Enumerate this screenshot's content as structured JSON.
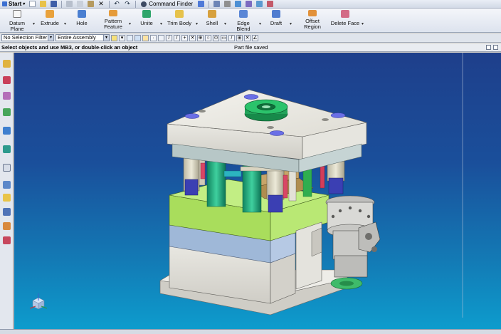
{
  "app": {
    "start_label": "Start",
    "command_finder_label": "Command Finder"
  },
  "ribbon": {
    "datum_plane": "Datum Plane",
    "extrude": "Extrude",
    "hole": "Hole",
    "pattern_feature_line1": "Pattern",
    "pattern_feature_line2": "Feature",
    "unite": "Unite",
    "trim_body": "Trim Body",
    "shell": "Shell",
    "edge_blend": "Edge Blend",
    "draft": "Draft",
    "offset_region_line1": "Offset",
    "offset_region_line2": "Region",
    "delete_face": "Delete Face"
  },
  "selection_bar": {
    "selection_filter": "No Selection Filter",
    "scope": "Entire Assembly"
  },
  "cue_line": {
    "prompt": "Select objects and use MB3, or double-click an object",
    "status": "Part file saved"
  },
  "colors": {
    "plate_gray": "#ecebe6",
    "cavity_green": "#a9dd5c",
    "accent_blue": "#9fb8d8",
    "bushing_green": "#1fae82",
    "sprue_green": "#22a35a",
    "viewport_top": "#1e3f8b",
    "viewport_bottom": "#0d9ccd"
  },
  "icons": [
    "start-icon",
    "new-icon",
    "open-icon",
    "save-icon",
    "cut-icon",
    "copy-icon",
    "paste-icon",
    "delete-icon",
    "undo-icon",
    "redo-icon",
    "command-finder-icon",
    "window-icon",
    "view-icon",
    "render-icon",
    "datum-plane-icon",
    "extrude-icon",
    "hole-icon",
    "pattern-feature-icon",
    "unite-icon",
    "trim-body-icon",
    "shell-icon",
    "edge-blend-icon",
    "draft-icon",
    "offset-region-icon",
    "delete-face-icon",
    "triad-icon"
  ]
}
